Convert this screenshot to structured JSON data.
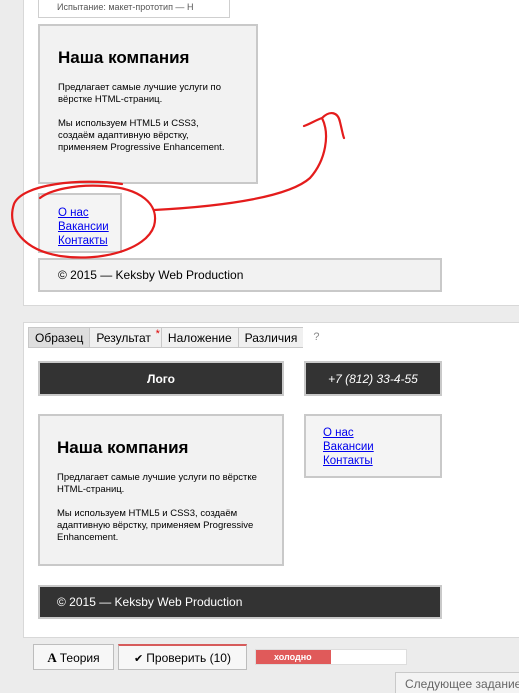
{
  "test_caption": "Испытание: макет-прототип — Н",
  "top_layout": {
    "title": "Наша компания",
    "para1": "Предлагает самые лучшие услуги по вёрстке HTML-страниц.",
    "para2": "Мы используем HTML5 и CSS3, создаём адаптивную вёрстку, применяем Progressive Enhancement.",
    "nav": [
      "О нас",
      "Вакансии",
      "Контакты"
    ],
    "footer": "© 2015 — Keksby Web Production"
  },
  "tabs": [
    {
      "label": "Образец",
      "active": true,
      "marked": false
    },
    {
      "label": "Результат",
      "active": false,
      "marked": true
    },
    {
      "label": "Наложение",
      "active": false,
      "marked": false
    },
    {
      "label": "Различия",
      "active": false,
      "marked": false
    }
  ],
  "tab_marker": "*",
  "help_label": "?",
  "reference_layout": {
    "logo": "Лого",
    "phone": "+7 (812) 33-4-55",
    "title": "Наша компания",
    "para1": "Предлагает самые лучшие услуги по вёрстке HTML-страниц.",
    "para2": "Мы используем HTML5 и CSS3, создаём адаптивную вёрстку, применяем Progressive Enhancement.",
    "nav": [
      "О нас",
      "Вакансии",
      "Контакты"
    ],
    "footer": "© 2015 — Keksby Web Production"
  },
  "toolbar": {
    "theory_icon": "A",
    "theory_label": "Теория",
    "check_icon": "✔",
    "check_label": "Проверить (10)",
    "progress_label": "холодно",
    "progress_fraction": 0.5,
    "next_label": "Следующее задание"
  },
  "colors": {
    "annotation_red": "#e41c1c",
    "progress_red": "#e05a5a",
    "dark_bar": "#333333"
  }
}
